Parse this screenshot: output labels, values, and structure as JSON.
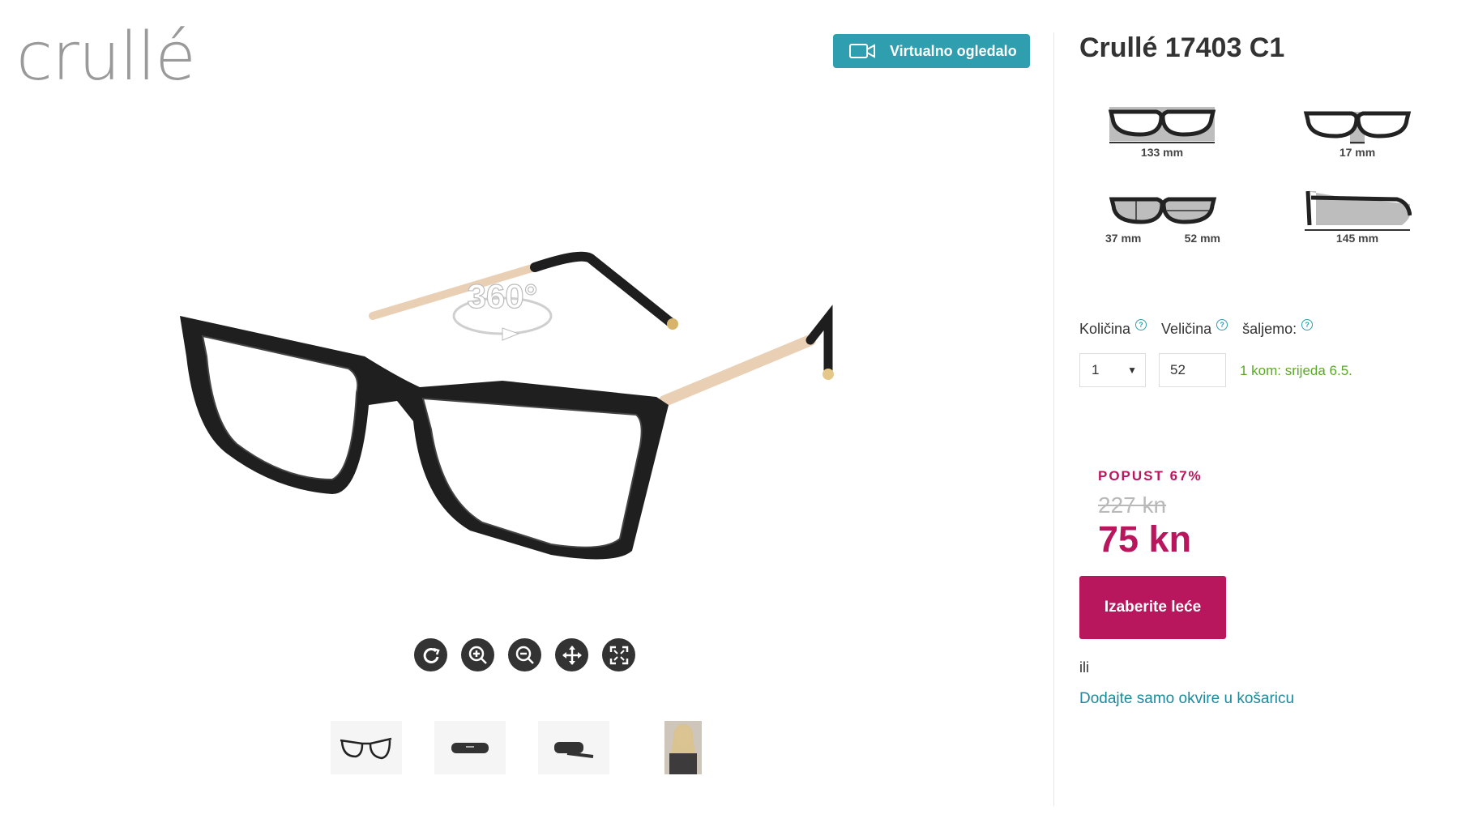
{
  "brand": {
    "logo_text": "crullé"
  },
  "vr_button": {
    "label": "Virtualno ogledalo",
    "icon": "video-camera-icon",
    "color": "#2f9fb0"
  },
  "viewer": {
    "badge": "360°",
    "controls": [
      "rotate-icon",
      "zoom-in-icon",
      "zoom-out-icon",
      "move-icon",
      "fullscreen-icon"
    ]
  },
  "thumbnails": [
    "glasses-thumb",
    "case-closed-thumb",
    "case-open-thumb",
    "model-photo-thumb"
  ],
  "product": {
    "title": "Crullé 17403 C1",
    "dimensions": {
      "total_width": "133 mm",
      "bridge": "17 mm",
      "lens_height": "37 mm",
      "lens_width": "52 mm",
      "temple_length": "145 mm"
    }
  },
  "options": {
    "quantity_label": "Količina",
    "size_label": "Veličina",
    "shipping_label": "šaljemo:",
    "quantity_value": "1",
    "size_value": "52",
    "delivery_text": "1 kom:  srijeda 6.5."
  },
  "pricing": {
    "discount_label": "POPUST 67%",
    "old_price": "227 kn",
    "new_price": "75 kn",
    "accent_color": "#b8175d"
  },
  "actions": {
    "choose_lenses": "Izaberite leće",
    "or_text": "ili",
    "add_frames_only": "Dodajte samo okvire u košaricu"
  }
}
